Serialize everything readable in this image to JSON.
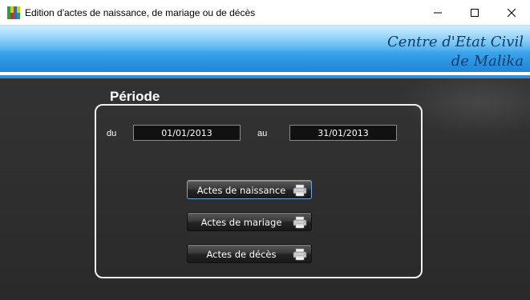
{
  "window": {
    "title": "Edition d'actes de naissance, de mariage ou de décès",
    "icons": [
      "app-icon",
      "minimize-icon",
      "maximize-icon",
      "close-icon"
    ]
  },
  "banner": {
    "line1": "Centre d'Etat Civil",
    "line2": "de Malika",
    "colors": {
      "text": "#123a66",
      "top": "#8fd6ff",
      "bottom": "#1f86d6"
    }
  },
  "periode": {
    "label": "Période",
    "from_label": "du",
    "from_value": "01/01/2013",
    "to_label": "au",
    "to_value": "31/01/2013"
  },
  "actions": {
    "naissance": "Actes de naissance",
    "mariage": "Actes de mariage",
    "deces": "Actes de décès",
    "icon": "printer-icon"
  }
}
